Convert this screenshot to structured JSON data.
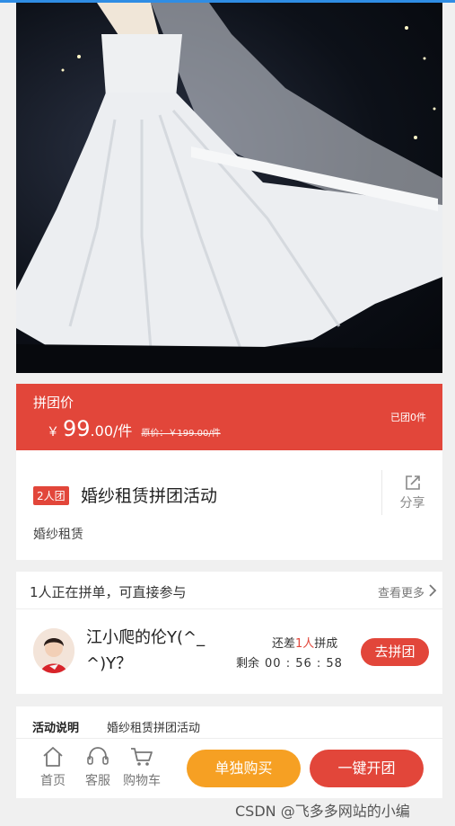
{
  "product": {
    "group_price_label": "拼团价",
    "currency": "￥",
    "price_int": "99",
    "price_dec": ".00/件",
    "original_price": "原价：￥199.00/件",
    "sold_count": "已团0件",
    "group_tag": "2人团",
    "title": "婚纱租赁拼团活动",
    "subtitle": "婚纱租赁",
    "share_label": "分享"
  },
  "groups": {
    "header": "1人正在拼单，可直接参与",
    "more_label": "查看更多",
    "item": {
      "username": "江小爬的伦Y(^_^)Y？",
      "need_prefix": "还差",
      "need_count": "1人",
      "need_suffix": "拼成",
      "remain_label": "剩余",
      "countdown": "00 : 56 : 58",
      "join_label": "去拼团"
    }
  },
  "activity": {
    "label": "活动说明",
    "text": "婚纱租赁拼团活动"
  },
  "bottom_nav": {
    "home": "首页",
    "service": "客服",
    "cart": "购物车",
    "buy_single": "单独购买",
    "open_group": "一键开团"
  },
  "watermark": "CSDN @飞多多网站的小编",
  "colors": {
    "accent_red": "#e2463a",
    "accent_orange": "#f6a023"
  }
}
